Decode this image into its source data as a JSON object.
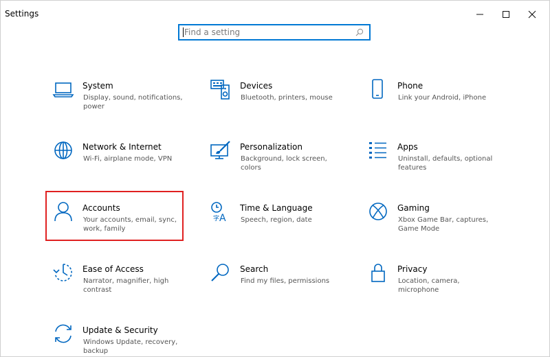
{
  "window": {
    "title": "Settings"
  },
  "search": {
    "placeholder": "Find a setting"
  },
  "items": [
    {
      "id": "system",
      "name": "System",
      "desc": "Display, sound, notifications, power"
    },
    {
      "id": "devices",
      "name": "Devices",
      "desc": "Bluetooth, printers, mouse"
    },
    {
      "id": "phone",
      "name": "Phone",
      "desc": "Link your Android, iPhone"
    },
    {
      "id": "network",
      "name": "Network & Internet",
      "desc": "Wi-Fi, airplane mode, VPN"
    },
    {
      "id": "personalization",
      "name": "Personalization",
      "desc": "Background, lock screen, colors"
    },
    {
      "id": "apps",
      "name": "Apps",
      "desc": "Uninstall, defaults, optional features"
    },
    {
      "id": "accounts",
      "name": "Accounts",
      "desc": "Your accounts, email, sync, work, family"
    },
    {
      "id": "time",
      "name": "Time & Language",
      "desc": "Speech, region, date"
    },
    {
      "id": "gaming",
      "name": "Gaming",
      "desc": "Xbox Game Bar, captures, Game Mode"
    },
    {
      "id": "ease",
      "name": "Ease of Access",
      "desc": "Narrator, magnifier, high contrast"
    },
    {
      "id": "search",
      "name": "Search",
      "desc": "Find my files, permissions"
    },
    {
      "id": "privacy",
      "name": "Privacy",
      "desc": "Location, camera, microphone"
    },
    {
      "id": "update",
      "name": "Update & Security",
      "desc": "Windows Update, recovery, backup"
    }
  ],
  "colors": {
    "accent": "#0067c0",
    "highlight": "#e02020",
    "search_border": "#0078d4"
  },
  "icons": {
    "system": "laptop-icon",
    "devices": "keyboard-speaker-icon",
    "phone": "phone-icon",
    "network": "globe-icon",
    "personalization": "paintbrush-icon",
    "apps": "list-icon",
    "accounts": "person-icon",
    "time": "time-language-icon",
    "gaming": "xbox-icon",
    "ease": "ease-of-access-icon",
    "search": "magnifier-icon",
    "privacy": "lock-icon",
    "update": "sync-icon"
  }
}
